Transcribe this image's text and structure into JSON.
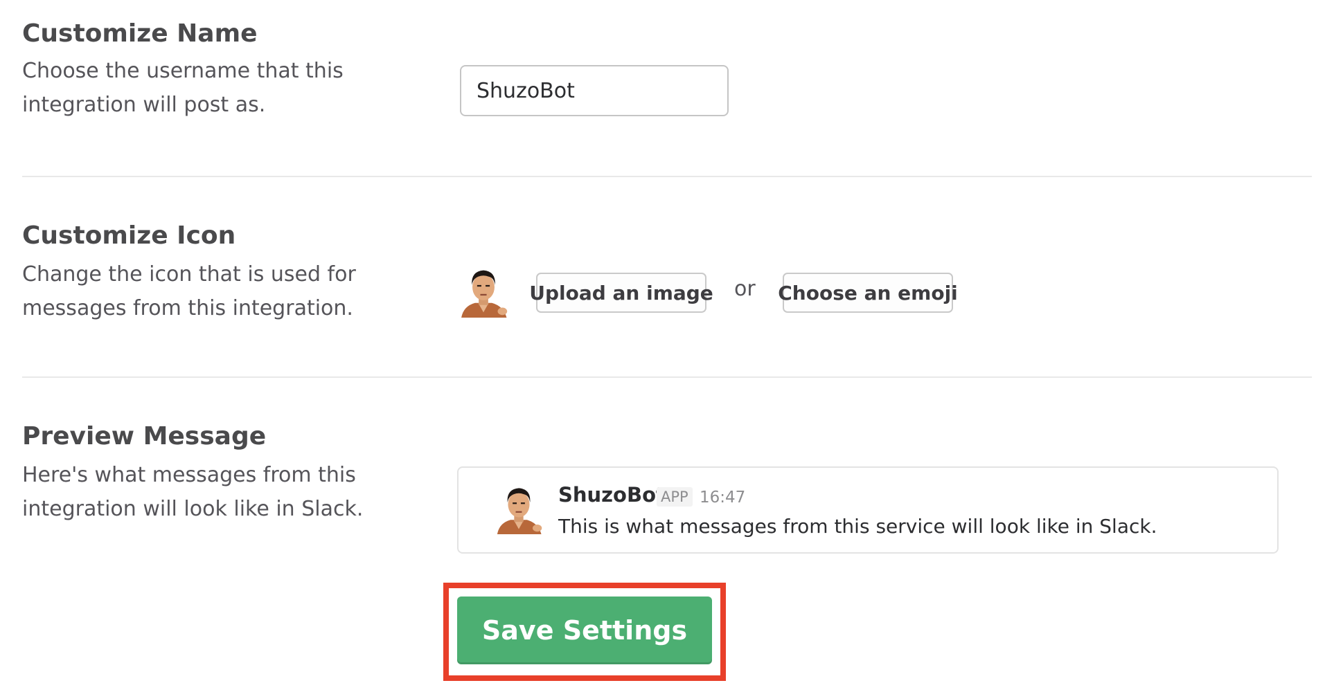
{
  "customize_name": {
    "title": "Customize Name",
    "description": "Choose the username that this integration will post as.",
    "username_value": "ShuzoBot"
  },
  "customize_icon": {
    "title": "Customize Icon",
    "description": "Change the icon that is used for messages from this integration.",
    "upload_label": "Upload an image",
    "or_label": "or",
    "emoji_label": "Choose an emoji",
    "avatar_icon": "user-photo-icon"
  },
  "preview": {
    "title": "Preview Message",
    "description": "Here's what messages from this integration will look like in Slack.",
    "message": {
      "name": "ShuzoBot",
      "badge": "APP",
      "time": "16:47",
      "text": "This is what messages from this service will look like in Slack."
    }
  },
  "actions": {
    "save_label": "Save Settings",
    "highlight_color": "#e8402a",
    "save_color": "#4caf72"
  }
}
